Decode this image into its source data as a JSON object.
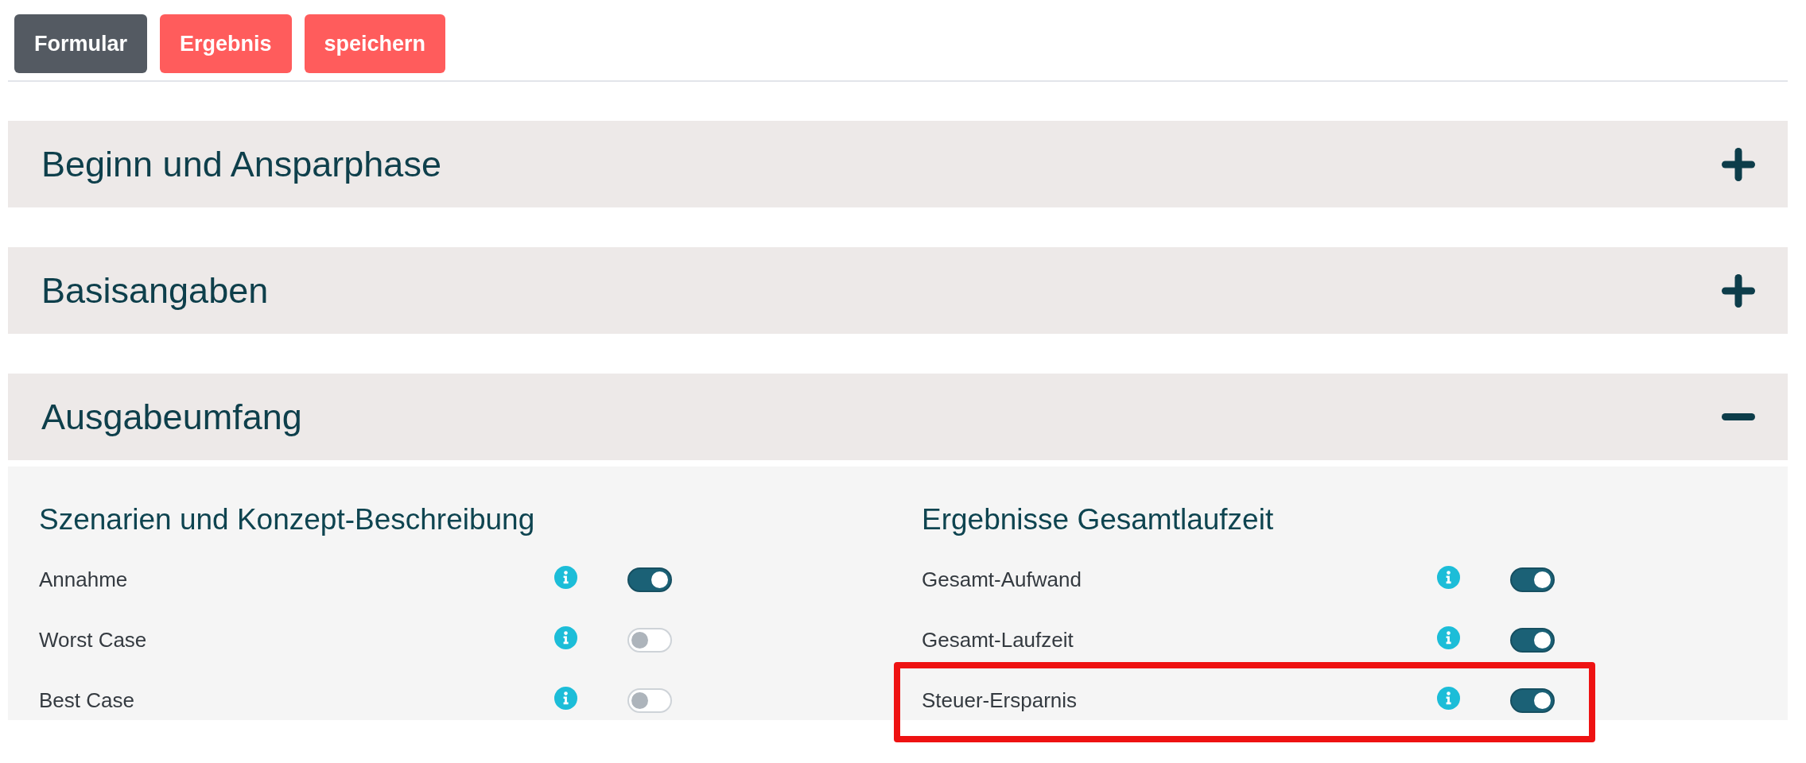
{
  "toolbar": [
    {
      "label": "Formular",
      "selected": true
    },
    {
      "label": "Ergebnis",
      "selected": false
    },
    {
      "label": "speichern",
      "selected": false
    }
  ],
  "sections": [
    {
      "title": "Beginn und Ansparphase",
      "expanded": false
    },
    {
      "title": "Basisangaben",
      "expanded": false
    },
    {
      "title": "Ausgabeumfang",
      "expanded": true,
      "columns": [
        {
          "heading": "Szenarien und Konzept-Beschreibung",
          "options": [
            {
              "label": "Annahme",
              "on": true,
              "highlighted": false
            },
            {
              "label": "Worst Case",
              "on": false,
              "highlighted": false
            },
            {
              "label": "Best Case",
              "on": false,
              "highlighted": false
            }
          ]
        },
        {
          "heading": "Ergebnisse Gesamtlaufzeit",
          "options": [
            {
              "label": "Gesamt-Aufwand",
              "on": true,
              "highlighted": false
            },
            {
              "label": "Gesamt-Laufzeit",
              "on": true,
              "highlighted": false
            },
            {
              "label": "Steuer-Ersparnis",
              "on": true,
              "highlighted": true
            }
          ]
        }
      ]
    }
  ]
}
